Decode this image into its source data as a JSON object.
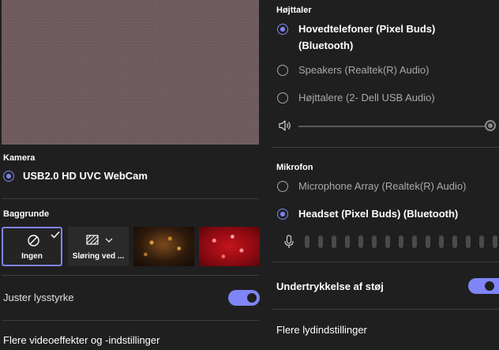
{
  "camera": {
    "section_label": "Kamera",
    "device": "USB2.0 HD UVC WebCam"
  },
  "backgrounds": {
    "section_label": "Baggrunde",
    "none_label": "Ingen",
    "blur_label": "Sløring ved ..."
  },
  "adjust_brightness": {
    "label": "Juster lysstyrke",
    "enabled": true
  },
  "more_video": "Flere videoeffekter og -indstillinger",
  "speaker": {
    "section_label": "Højttaler",
    "options": [
      {
        "label_line1": "Hovedtelefoner (Pixel Buds)",
        "label_line2": "(Bluetooth)",
        "selected": true
      },
      {
        "label": "Speakers (Realtek(R) Audio)",
        "selected": false
      },
      {
        "label": "Højttalere (2- Dell USB Audio)",
        "selected": false
      }
    ],
    "volume_percent": 100
  },
  "microphone": {
    "section_label": "Mikrofon",
    "options": [
      {
        "label": "Microphone Array (Realtek(R) Audio)",
        "selected": false
      },
      {
        "label": "Headset (Pixel Buds) (Bluetooth)",
        "selected": true
      }
    ],
    "level_percent": 0
  },
  "noise_suppression": {
    "label": "Undertrykkelse af støj",
    "enabled": true
  },
  "more_audio": "Flere lydindstillinger",
  "colors": {
    "accent": "#7f85f5",
    "background": "#1f1f1f"
  }
}
